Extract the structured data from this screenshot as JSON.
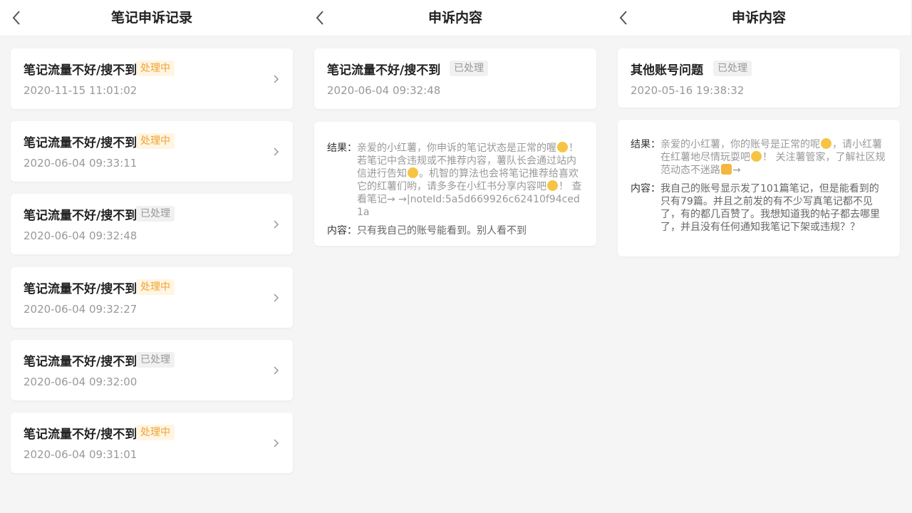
{
  "screens": [
    {
      "title": "笔记申诉记录",
      "records": [
        {
          "title": "笔记流量不好/搜不到",
          "status": "处理中",
          "time": "2020-11-15 11:01:02"
        },
        {
          "title": "笔记流量不好/搜不到",
          "status": "处理中",
          "time": "2020-06-04 09:33:11"
        },
        {
          "title": "笔记流量不好/搜不到",
          "status": "已处理",
          "time": "2020-06-04 09:32:48"
        },
        {
          "title": "笔记流量不好/搜不到",
          "status": "处理中",
          "time": "2020-06-04 09:32:27"
        },
        {
          "title": "笔记流量不好/搜不到",
          "status": "已处理",
          "time": "2020-06-04 09:32:00"
        },
        {
          "title": "笔记流量不好/搜不到",
          "status": "处理中",
          "time": "2020-06-04 09:31:01"
        }
      ]
    },
    {
      "title": "申诉内容",
      "summary": {
        "title": "笔记流量不好/搜不到",
        "status": "已处理",
        "time": "2020-06-04 09:32:48"
      },
      "result_label": "结果：",
      "result_parts": [
        "亲爱的小红薯，你申诉的笔记状态是正常的喔",
        "！ 若笔记中含违规或不推荐内容，薯队长会通过站内信进行告知",
        "。机智的算法也会将笔记推荐给喜欢它的红薯们哟，请多多在小红书分享内容吧",
        "！ 查看笔记→ →|noteId:5a5d669926c62410f94ced1a"
      ],
      "content_label": "内容：",
      "content": "只有我自己的账号能看到。别人看不到"
    },
    {
      "title": "申诉内容",
      "summary": {
        "title": "其他账号问题",
        "status": "已处理",
        "time": "2020-05-16 19:38:32"
      },
      "result_label": "结果：",
      "result_parts": [
        "亲爱的小红薯，你的账号是正常的呢",
        "，请小红薯在红薯地尽情玩耍吧",
        "！ 关注薯管家，了解社区规范动态不迷路",
        "→"
      ],
      "content_label": "内容：",
      "content": "我自己的账号显示发了101篇笔记，但是能看到的只有79篇。并且之前发的有不少写真笔记都不见了，有的都几百赞了。我想知道我的帖子都去哪里了，并且没有任何通知我笔记下架或违规？？"
    }
  ],
  "icons": {
    "back": "back-chevron-icon",
    "arrow": "chevron-right-icon",
    "emoji": "emoji-icon"
  },
  "colors": {
    "pending_text": "#f0a232",
    "pending_bg": "#fff5e2",
    "done_text": "#999999",
    "done_bg": "#f1f1f1"
  }
}
